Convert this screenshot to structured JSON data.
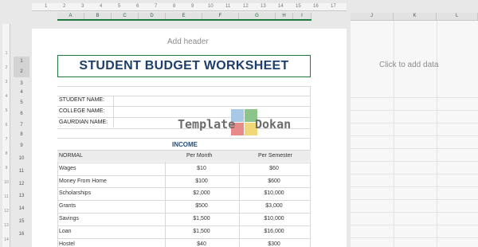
{
  "ruler_top": [
    "1",
    "2",
    "3",
    "4",
    "5",
    "6",
    "7",
    "8",
    "9",
    "10",
    "11",
    "12",
    "13",
    "14",
    "15",
    "16",
    "17",
    "18",
    "19"
  ],
  "columns": [
    "A",
    "B",
    "C",
    "D",
    "E",
    "F",
    "G",
    "H",
    "I"
  ],
  "columns_right": [
    "J",
    "K",
    "L"
  ],
  "ruler_left": [
    "1",
    "2",
    "3",
    "4",
    "5",
    "6",
    "7",
    "8",
    "9",
    "10",
    "11",
    "12",
    "13",
    "14"
  ],
  "rows": [
    "1",
    "2",
    "3",
    "4",
    "5",
    "6",
    "7",
    "8",
    "9",
    "10",
    "11",
    "12",
    "13",
    "14",
    "15",
    "16"
  ],
  "page": {
    "add_header": "Add header",
    "title": "STUDENT BUDGET WORKSHEET",
    "labels": {
      "student_name": "STUDENT NAME:",
      "college_name": "COLLEGE NAME:",
      "guardian_name": "GAURDIAN NAME:"
    },
    "income_heading": "INCOME",
    "table": {
      "headers": [
        "NORMAL",
        "Per Month",
        "Per Semester"
      ],
      "rows": [
        {
          "label": "Wages",
          "month": "$10",
          "semester": "$60"
        },
        {
          "label": "Money From Home",
          "month": "$100",
          "semester": "$600"
        },
        {
          "label": "Scholarships",
          "month": "$2,000",
          "semester": "$10,000"
        },
        {
          "label": "Grants",
          "month": "$500",
          "semester": "$3,000"
        },
        {
          "label": "Savings",
          "month": "$1,500",
          "semester": "$10,000"
        },
        {
          "label": "Loan",
          "month": "$1,500",
          "semester": "$16,000"
        },
        {
          "label": "Hostel",
          "month": "$40",
          "semester": "$300"
        }
      ]
    }
  },
  "watermark": {
    "word1": "Template",
    "word2": "Dokan"
  },
  "right_page": {
    "hint": "Click to add data"
  },
  "colors": {
    "accent_green": "#1f7a3f",
    "title_blue": "#1f3f6b",
    "income_blue": "#1f4e79",
    "logo_blue": "#a8c8e8",
    "logo_green": "#8cc58c",
    "logo_red": "#e88a8a",
    "logo_yellow": "#f0d878"
  }
}
